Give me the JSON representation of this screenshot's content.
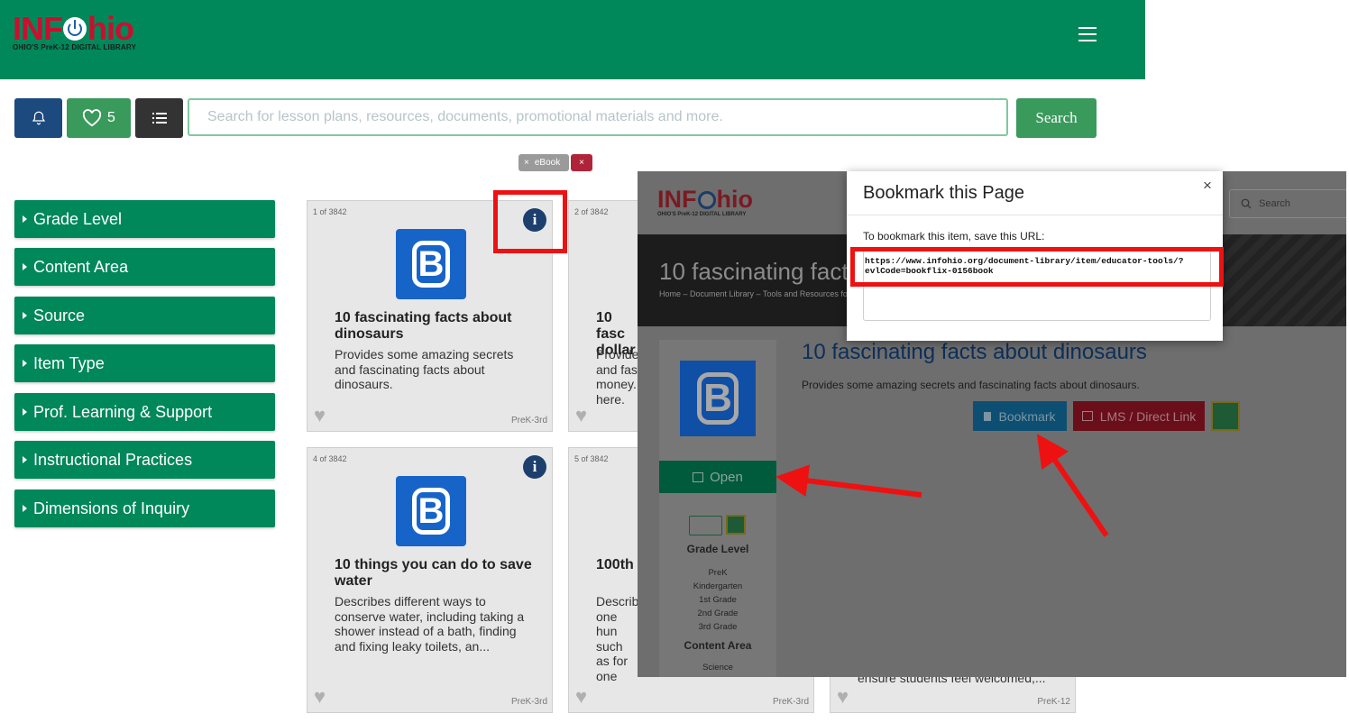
{
  "header": {
    "logo_main_left": "INF",
    "logo_main_right": "hio",
    "logo_sub": "OHIO'S PreK-12 DIGITAL LIBRARY"
  },
  "toolbar": {
    "favorites_count": "5",
    "search_placeholder": "Search for lesson plans, resources, documents, promotional materials and more.",
    "search_button": "Search"
  },
  "filters": {
    "chip_label": "eBook",
    "chip_remove": "×",
    "chip_clear": "×"
  },
  "sidebar": {
    "items": [
      {
        "label": "Grade Level"
      },
      {
        "label": "Content Area"
      },
      {
        "label": "Source"
      },
      {
        "label": "Item Type"
      },
      {
        "label": "Prof. Learning & Support"
      },
      {
        "label": "Instructional Practices"
      },
      {
        "label": "Dimensions of Inquiry"
      }
    ]
  },
  "cards": [
    {
      "count": "1 of 3842",
      "title": "10 fascinating facts about dinosaurs",
      "desc": "Provides some amazing secrets and fascinating facts about dinosaurs.",
      "grade": "PreK-3rd"
    },
    {
      "count": "2 of 3842",
      "title": "10 fasc dollar",
      "desc": "Provide and fas money. here.",
      "grade": ""
    },
    {
      "count": "4 of 3842",
      "title": "10 things you can do to save water",
      "desc": "Describes different ways to conserve water, including taking a shower instead of a bath, finding and fixing leaky toilets, an...",
      "grade": "PreK-3rd"
    },
    {
      "count": "5 of 3842",
      "title": "100th",
      "desc": "Describ one hun such as for one",
      "grade": "PreK-3rd"
    },
    {
      "desc_partial": "ensure students feel welcomed,...",
      "grade": "PreK-12"
    }
  ],
  "detail": {
    "logo_left": "INF",
    "logo_right": "hio",
    "logo_sub": "OHIO'S PreK-12 DIGITAL LIBRARY",
    "search_placeholder": "Search",
    "banner_title": "10 fascinating fact",
    "breadcrumb": "Home – Document Library – Tools and Resources for",
    "title": "10 fascinating facts about dinosaurs",
    "desc": "Provides some amazing secrets and fascinating facts about dinosaurs.",
    "bookmark_button": "Bookmark",
    "lms_button": "LMS / Direct Link",
    "open_button": "Open",
    "grade_heading": "Grade Level",
    "grades": [
      "PreK",
      "Kindergarten",
      "1st Grade",
      "2nd Grade",
      "3rd Grade"
    ],
    "content_heading": "Content Area",
    "content_value": "Science"
  },
  "modal": {
    "title": "Bookmark this Page",
    "close": "×",
    "instruction": "To bookmark this item, save this URL:",
    "url_line1": "https://www.infohio.org/document-library/item/educator-tools/?",
    "url_line2": "evlCode=bookflix-0156book"
  },
  "colors": {
    "brand_green": "#00875a",
    "brand_red": "#c8102e",
    "navy": "#1c4a7e",
    "annotation_red": "#ee1111"
  }
}
